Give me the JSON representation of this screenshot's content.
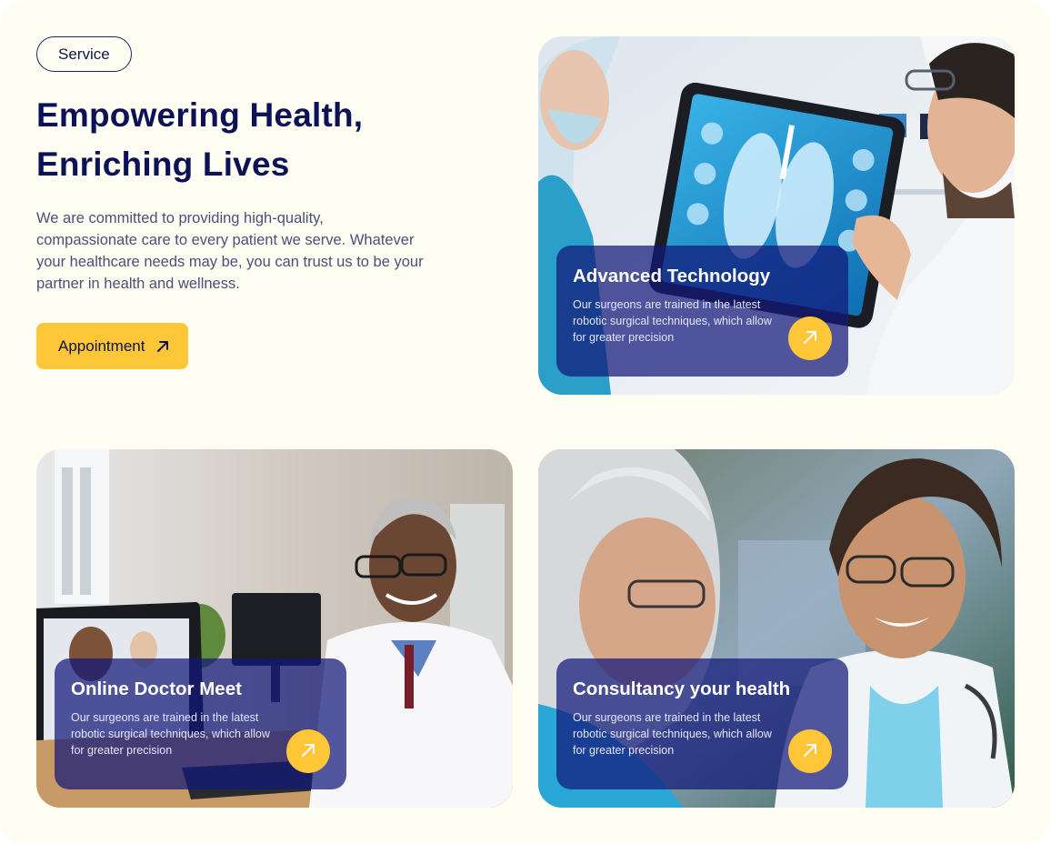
{
  "intro": {
    "tag": "Service",
    "headline_line1": "Empowering Health,",
    "headline_line2": "Enriching Lives",
    "description": "We are committed to providing high-quality, compassionate care to every patient we serve. Whatever your healthcare needs may be, you can trust us to be your partner in health and wellness.",
    "cta_label": "Appointment"
  },
  "cards": [
    {
      "title": "Advanced Technology",
      "text": "Our surgeons are trained in the latest robotic surgical techniques, which allow for greater precision"
    },
    {
      "title": "Online Doctor Meet",
      "text": "Our surgeons are trained in the latest robotic surgical techniques, which allow for greater precision"
    },
    {
      "title": "Consultancy your health",
      "text": "Our surgeons are trained in the latest robotic surgical techniques, which allow for greater precision"
    }
  ],
  "icons": {
    "cta": "arrow-up-right-icon",
    "card_button": "arrow-up-right-icon"
  },
  "colors": {
    "background": "#fefef3",
    "heading": "#0d1257",
    "accent": "#ffc638",
    "overlay": "#121878"
  }
}
